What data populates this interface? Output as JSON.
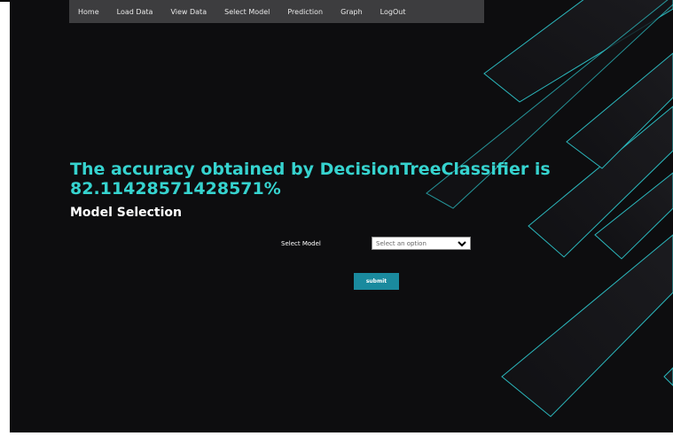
{
  "nav": {
    "items": [
      "Home",
      "Load Data",
      "View Data",
      "Select Model",
      "Prediction",
      "Graph",
      "LogOut"
    ]
  },
  "result": {
    "text": "The accuracy obtained by DecisionTreeClassifier is 82.11428571428571%"
  },
  "form": {
    "title": "Model Selection",
    "select_label": "Select Model",
    "select_value": "Select an option",
    "submit_label": "submit"
  },
  "colors": {
    "accent": "#36d3cf",
    "background": "#0d0d0f",
    "navbar": "#3d3d3f",
    "button": "#1a8a9e"
  },
  "icons": {
    "select_arrow": "chevron-down-icon"
  }
}
